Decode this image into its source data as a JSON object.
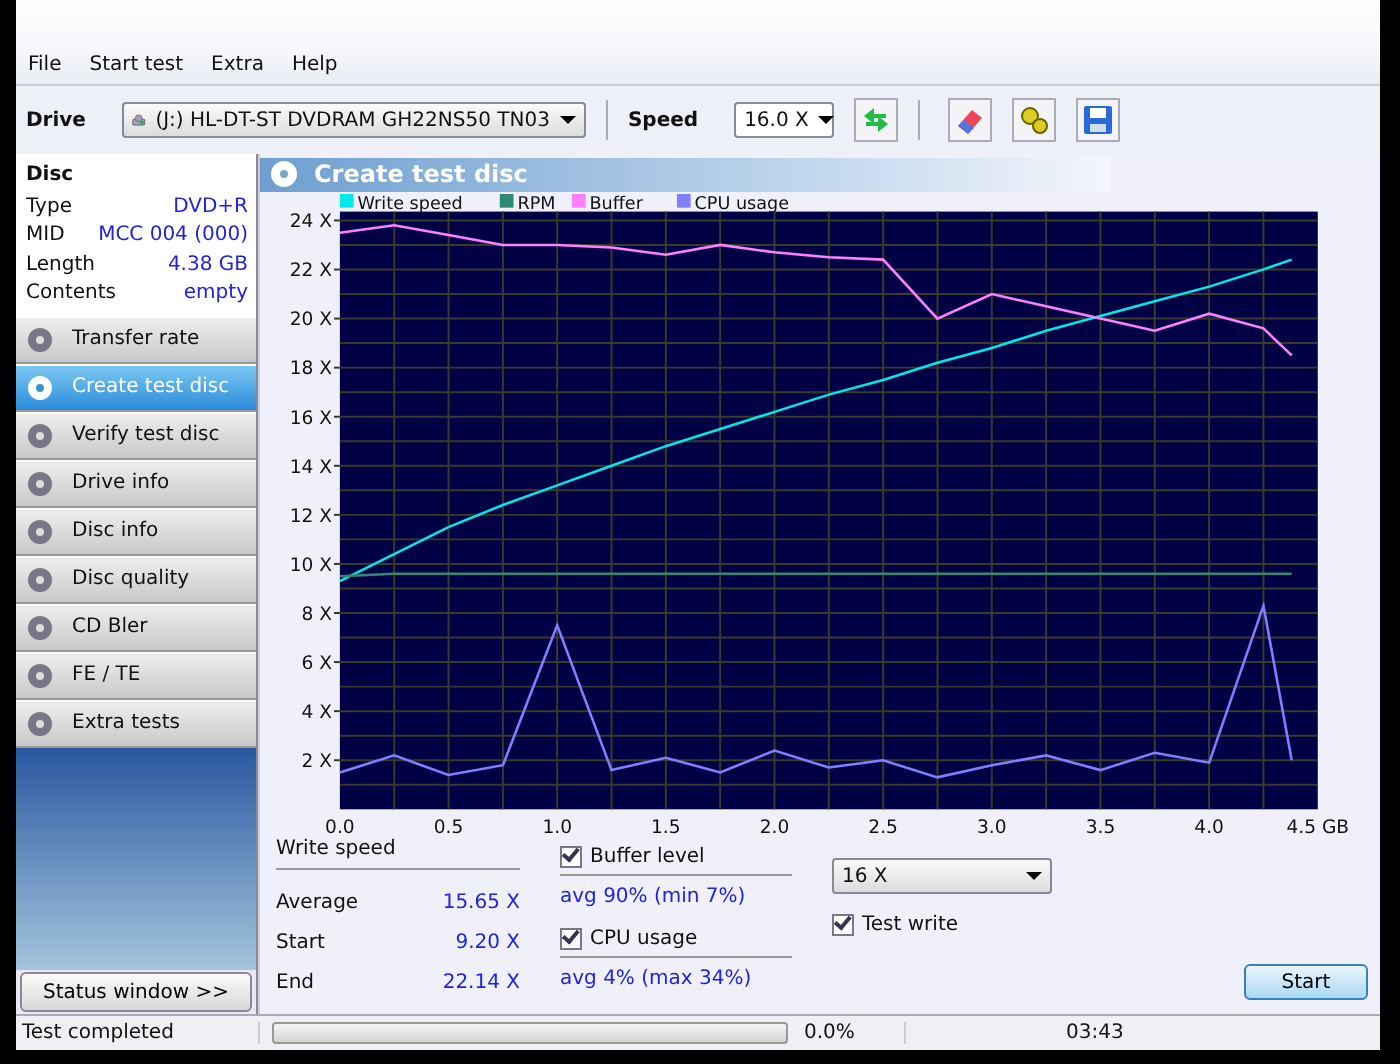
{
  "menu": [
    "File",
    "Start test",
    "Extra",
    "Help"
  ],
  "toolbar": {
    "drive_label": "Drive",
    "drive": "(J:)  HL-DT-ST DVDRAM GH22NS50 TN03",
    "speed_label": "Speed",
    "speed": "16.0 X"
  },
  "disc": {
    "title": "Disc",
    "rows": [
      {
        "label": "Type",
        "value": "DVD+R"
      },
      {
        "label": "MID",
        "value": "MCC 004 (000)"
      },
      {
        "label": "Length",
        "value": "4.38 GB"
      },
      {
        "label": "Contents",
        "value": "empty"
      }
    ]
  },
  "nav": [
    {
      "label": "Transfer rate",
      "selected": false
    },
    {
      "label": "Create test disc",
      "selected": true
    },
    {
      "label": "Verify test disc",
      "selected": false
    },
    {
      "label": "Drive info",
      "selected": false
    },
    {
      "label": "Disc info",
      "selected": false
    },
    {
      "label": "Disc quality",
      "selected": false
    },
    {
      "label": "CD Bler",
      "selected": false
    },
    {
      "label": "FE / TE",
      "selected": false
    },
    {
      "label": "Extra tests",
      "selected": false
    }
  ],
  "status_window_button": "Status window >>",
  "panel_title": "Create test disc",
  "chart_data": {
    "type": "line",
    "x": [
      0,
      0.25,
      0.5,
      0.75,
      1,
      1.25,
      1.5,
      1.75,
      2,
      2.25,
      2.5,
      2.75,
      3,
      3.25,
      3.5,
      3.75,
      4,
      4.25,
      4.38
    ],
    "series": [
      {
        "name": "Write speed",
        "color": "#00e8e8",
        "values": [
          9.3,
          10.4,
          11.5,
          12.4,
          13.2,
          14.0,
          14.8,
          15.5,
          16.2,
          16.9,
          17.5,
          18.2,
          18.8,
          19.5,
          20.1,
          20.7,
          21.3,
          22.0,
          22.4
        ]
      },
      {
        "name": "RPM",
        "color": "#2e8b72",
        "values": [
          9.5,
          9.6,
          9.6,
          9.6,
          9.6,
          9.6,
          9.6,
          9.6,
          9.6,
          9.6,
          9.6,
          9.6,
          9.6,
          9.6,
          9.6,
          9.6,
          9.6,
          9.6,
          9.6
        ]
      },
      {
        "name": "Buffer",
        "color": "#ff80ff",
        "values": [
          23.5,
          23.8,
          23.4,
          23.0,
          23.0,
          22.9,
          22.6,
          23.0,
          22.7,
          22.5,
          22.4,
          20.0,
          21.0,
          20.5,
          20.0,
          19.5,
          20.2,
          19.6,
          18.5
        ]
      },
      {
        "name": "CPU usage",
        "color": "#8080ff",
        "values": [
          1.5,
          2.2,
          1.4,
          1.8,
          7.5,
          1.6,
          2.1,
          1.5,
          2.4,
          1.7,
          2.0,
          1.3,
          1.8,
          2.2,
          1.6,
          2.3,
          1.9,
          8.3,
          2.0
        ]
      }
    ],
    "grid": true,
    "legend": true,
    "xlim": [
      0,
      4.5
    ],
    "ylim": [
      0,
      24.2
    ],
    "xticks": [
      {
        "value": 0,
        "label": "0.0"
      },
      0.5,
      {
        "value": 1,
        "label": "1.0"
      },
      1.5,
      {
        "value": 2,
        "label": "2.0"
      },
      2.5,
      {
        "value": 3,
        "label": "3.0"
      },
      3.5,
      {
        "value": 4,
        "label": "4.0"
      },
      {
        "value": 4.5,
        "label": "4.5 GB"
      }
    ],
    "yticks": [
      {
        "value": 2,
        "label": "2 X"
      },
      {
        "value": 4,
        "label": "4 X"
      },
      {
        "value": 6,
        "label": "6 X"
      },
      {
        "value": 8,
        "label": "8 X"
      },
      {
        "value": 10,
        "label": "10 X"
      },
      {
        "value": 12,
        "label": "12 X"
      },
      {
        "value": 14,
        "label": "14 X"
      },
      {
        "value": 16,
        "label": "16 X"
      },
      {
        "value": 18,
        "label": "18 X"
      },
      {
        "value": 20,
        "label": "20 X"
      },
      {
        "value": 22,
        "label": "22 X"
      },
      {
        "value": 24,
        "label": "24 X"
      }
    ]
  },
  "stats": {
    "heading": "Write speed",
    "rows": [
      {
        "label": "Average",
        "value": "15.65 X"
      },
      {
        "label": "Start",
        "value": "9.20 X"
      },
      {
        "label": "End",
        "value": "22.14 X"
      }
    ]
  },
  "buffer": {
    "label": "Buffer level",
    "checked": true,
    "summary": "avg 90% (min 7%)"
  },
  "cpu": {
    "label": "CPU usage",
    "checked": true,
    "summary": "avg 4% (max 34%)"
  },
  "write_speed_select": "16 X",
  "test_write": {
    "label": "Test write",
    "checked": true
  },
  "start_button": "Start",
  "status_bar": {
    "message": "Test completed",
    "level": 0,
    "percent": "0.0%",
    "time": "03:43"
  }
}
